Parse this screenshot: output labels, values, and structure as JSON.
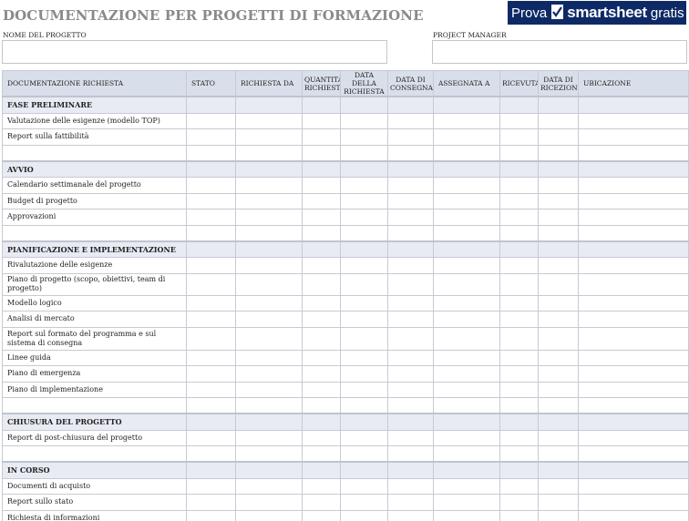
{
  "header": {
    "title": "DOCUMENTAZIONE PER PROGETTI DI FORMAZIONE",
    "banner": {
      "prova": "Prova",
      "brand": "smartsheet",
      "gratis": "gratis"
    },
    "project_name_label": "NOME DEL PROGETTO",
    "project_manager_label": "PROJECT MANAGER"
  },
  "table": {
    "columns": [
      "DOCUMENTAZIONE RICHIESTA",
      "STATO",
      "RICHIESTA DA",
      "QUANTITÀ RICHIESTA",
      "DATA DELLA RICHIESTA",
      "DATA DI CONSEGNA",
      "ASSEGNATA A",
      "RICEVUTA",
      "DATA DI RICEZIONE",
      "UBICAZIONE"
    ],
    "sections": [
      {
        "name": "FASE PRELIMINARE",
        "items": [
          "Valutazione delle esigenze (modello TOP)",
          "Report sulla fattibilità",
          ""
        ]
      },
      {
        "name": "AVVIO",
        "items": [
          "Calendario settimanale del progetto",
          "Budget di progetto",
          "Approvazioni",
          ""
        ]
      },
      {
        "name": "PIANIFICAZIONE E IMPLEMENTAZIONE",
        "items": [
          "Rivalutazione delle esigenze",
          "Piano di progetto (scopo, obiettivi, team di progetto)",
          "Modello logico",
          "Analisi di mercato",
          "Report sul formato del programma e sul sistema di consegna",
          "Linee guida",
          "Piano di emergenza",
          "Piano di implementazione",
          ""
        ]
      },
      {
        "name": "CHIUSURA DEL PROGETTO",
        "items": [
          "Report di post-chiusura del progetto",
          ""
        ]
      },
      {
        "name": "IN CORSO",
        "items": [
          "Documenti di acquisto",
          "Report sullo stato",
          "Richiesta di informazioni"
        ]
      }
    ]
  }
}
